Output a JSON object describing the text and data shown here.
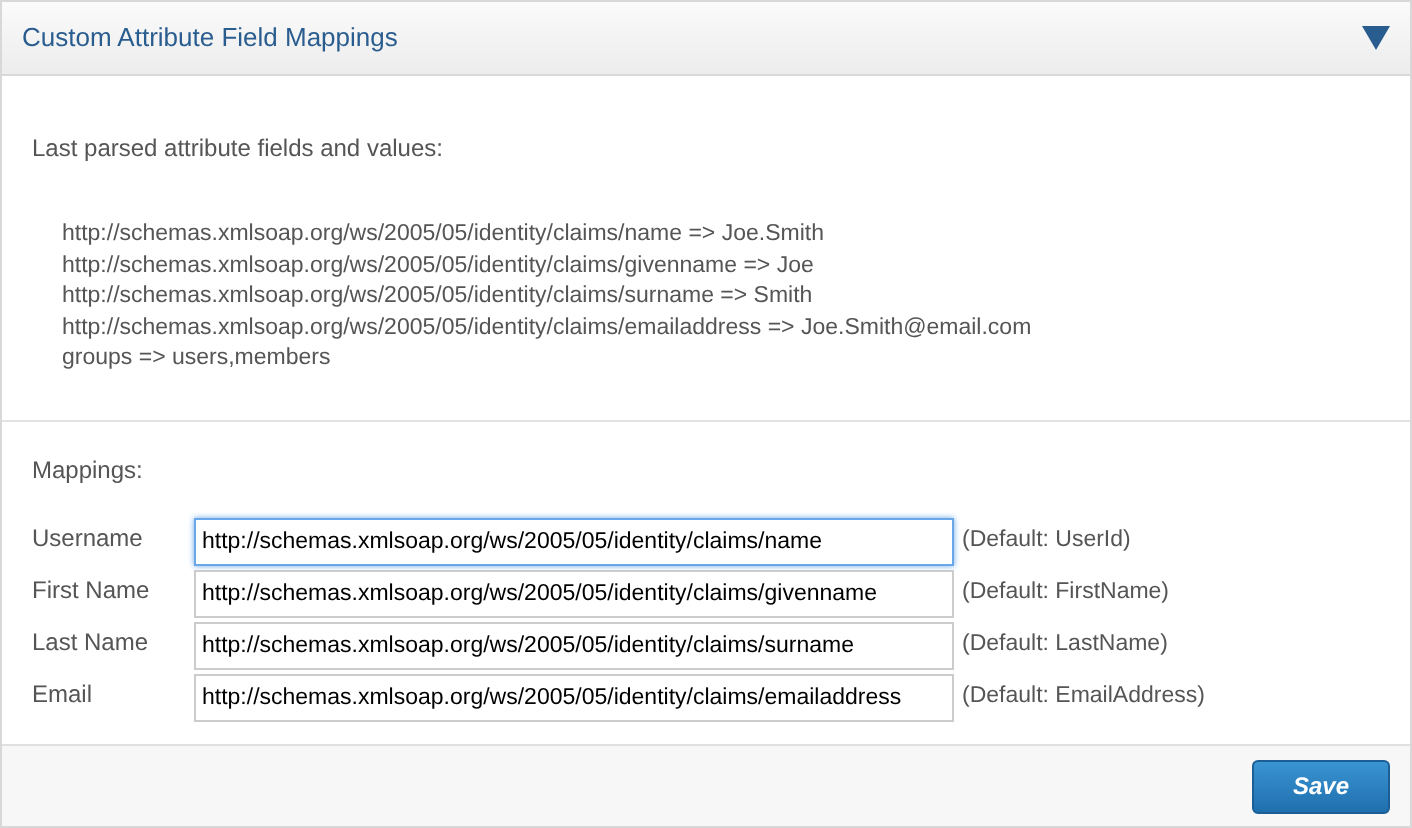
{
  "panel": {
    "title": "Custom Attribute Field Mappings",
    "expanded": true
  },
  "parsed": {
    "heading": "Last parsed attribute fields and values:",
    "lines": [
      "http://schemas.xmlsoap.org/ws/2005/05/identity/claims/name => Joe.Smith",
      "http://schemas.xmlsoap.org/ws/2005/05/identity/claims/givenname => Joe",
      "http://schemas.xmlsoap.org/ws/2005/05/identity/claims/surname => Smith",
      "http://schemas.xmlsoap.org/ws/2005/05/identity/claims/emailaddress => Joe.Smith@email.com",
      "groups => users,members"
    ]
  },
  "mappings": {
    "heading": "Mappings:",
    "rows": [
      {
        "label": "Username",
        "value": "http://schemas.xmlsoap.org/ws/2005/05/identity/claims/name",
        "default": "(Default: UserId)",
        "focused": true
      },
      {
        "label": "First Name",
        "value": "http://schemas.xmlsoap.org/ws/2005/05/identity/claims/givenname",
        "default": "(Default: FirstName)",
        "focused": false
      },
      {
        "label": "Last Name",
        "value": "http://schemas.xmlsoap.org/ws/2005/05/identity/claims/surname",
        "default": "(Default: LastName)",
        "focused": false
      },
      {
        "label": "Email",
        "value": "http://schemas.xmlsoap.org/ws/2005/05/identity/claims/emailaddress",
        "default": "(Default: EmailAddress)",
        "focused": false
      }
    ]
  },
  "save_button": "Save"
}
